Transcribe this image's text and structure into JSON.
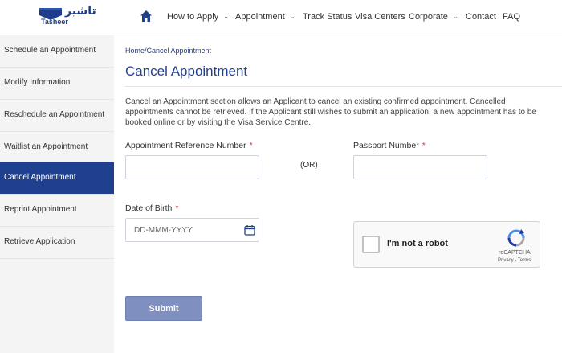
{
  "brand": {
    "arabic_name": "تاشير",
    "english_name": "Tasheer",
    "color": "#1b3e8c"
  },
  "nav": {
    "home_icon": "home-icon",
    "items": [
      {
        "label": "How to Apply",
        "dropdown": true
      },
      {
        "label": "Appointment",
        "dropdown": true
      },
      {
        "label": "Track Status",
        "dropdown": false
      },
      {
        "label": "Visa Centers",
        "dropdown": false
      },
      {
        "label": "Corporate",
        "dropdown": true
      },
      {
        "label": "Contact",
        "dropdown": false
      },
      {
        "label": "FAQ",
        "dropdown": false
      }
    ]
  },
  "sidebar": {
    "items": [
      {
        "label": "Schedule an Appointment",
        "active": false
      },
      {
        "label": "Modify Information",
        "active": false
      },
      {
        "label": "Reschedule an Appointment",
        "active": false
      },
      {
        "label": "Waitlist an Appointment",
        "active": false
      },
      {
        "label": "Cancel Appointment",
        "active": true
      },
      {
        "label": "Reprint Appointment",
        "active": false
      },
      {
        "label": "Retrieve Application",
        "active": false
      }
    ],
    "active_color": "#1f3f8f"
  },
  "main": {
    "breadcrumb": "Home/Cancel Appointment",
    "title": "Cancel Appointment",
    "description": "Cancel an Appointment section allows an Applicant to cancel an existing confirmed appointment. Cancelled appointments cannot be retrieved. If the Applicant still wishes to submit an application, a new appointment has to be booked online or by visiting the Visa Service Centre.",
    "form": {
      "reference_label": "Appointment Reference Number",
      "reference_value": "",
      "or_text": "(OR)",
      "passport_label": "Passport Number",
      "passport_value": "",
      "dob_label": "Date of Birth",
      "dob_placeholder": "DD-MMM-YYYY",
      "required_mark": "*",
      "captcha": {
        "label": "I'm not a robot",
        "brand": "reCAPTCHA",
        "links": "Privacy - Terms",
        "checked": false
      },
      "submit_label": "Submit"
    }
  }
}
